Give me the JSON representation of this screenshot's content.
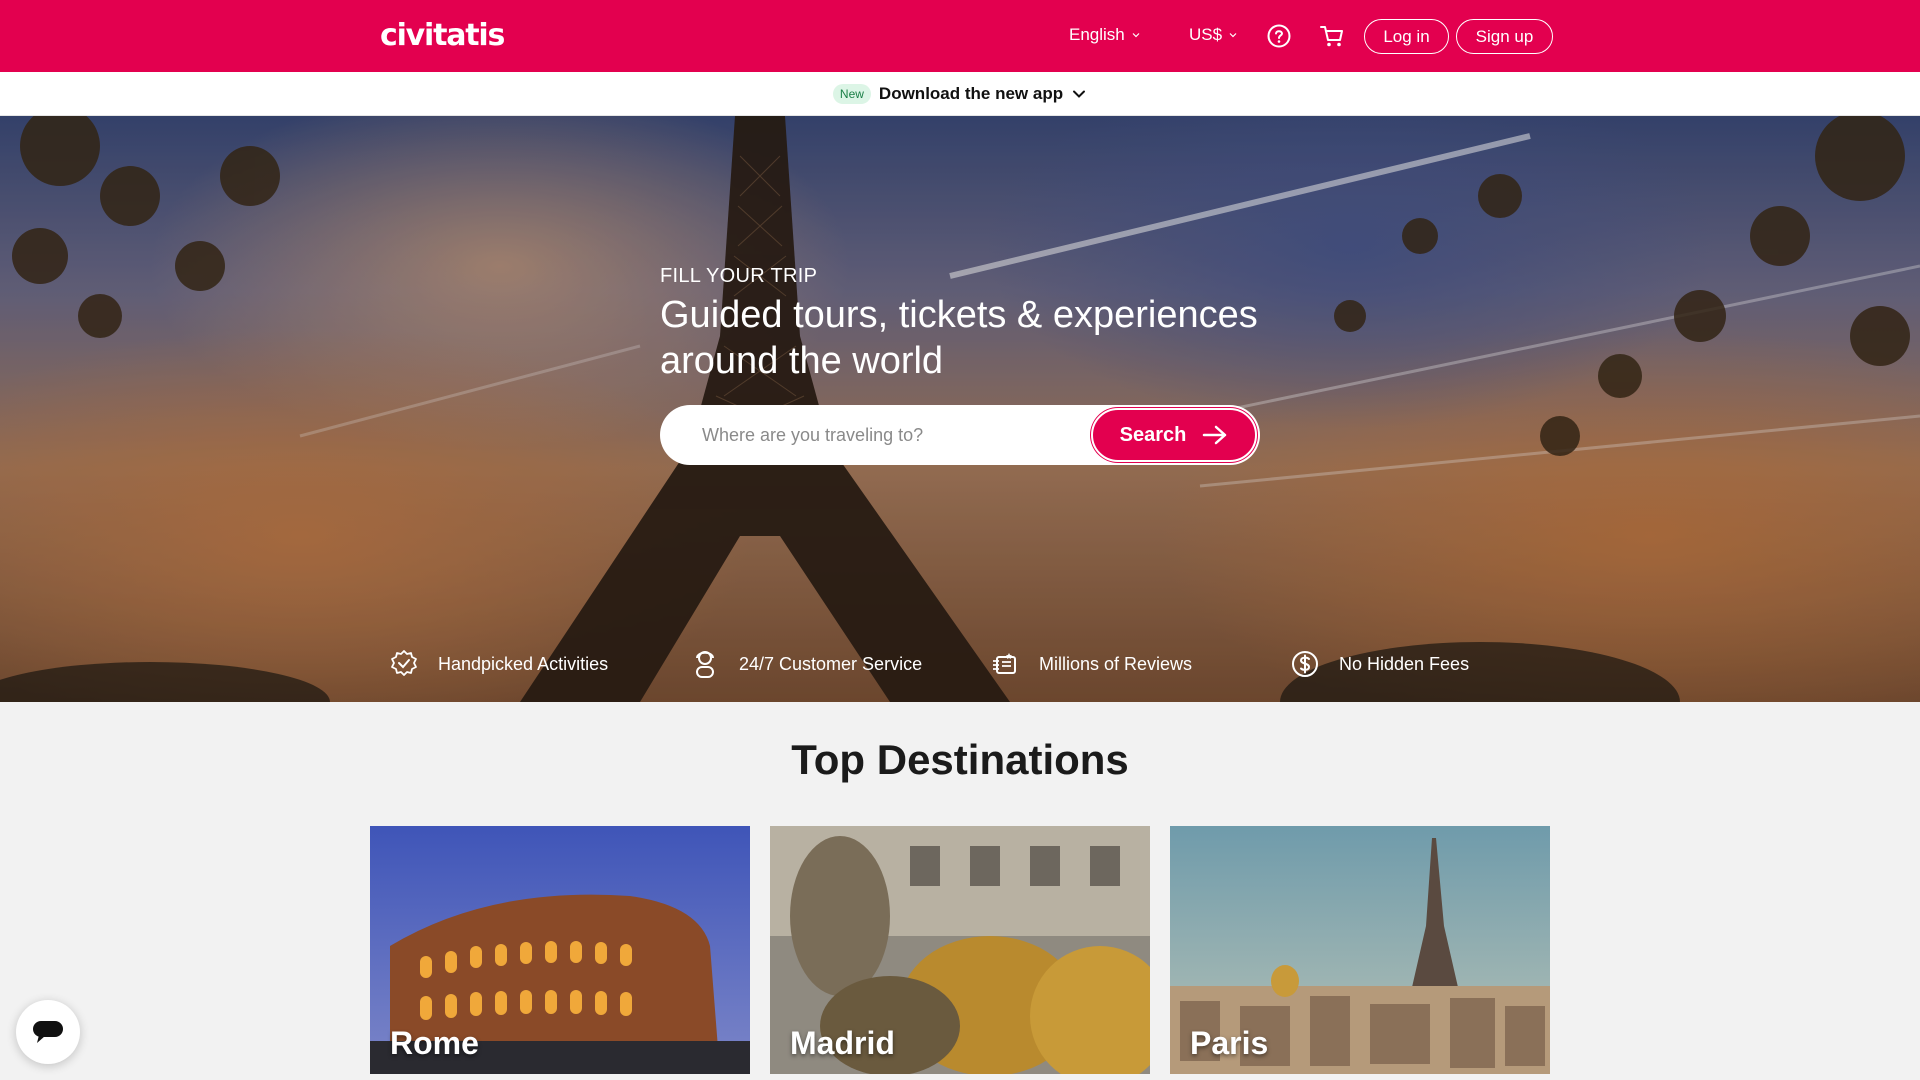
{
  "header": {
    "logo": "civitatis",
    "language": "English",
    "currency": "US$",
    "login_label": "Log in",
    "signup_label": "Sign up"
  },
  "app_banner": {
    "badge": "New",
    "label": "Download the new app"
  },
  "hero": {
    "kicker": "FILL YOUR TRIP",
    "headline": "Guided tours, tickets & experiences around the world",
    "search_placeholder": "Where are you traveling to?",
    "search_button": "Search",
    "features": [
      {
        "icon": "verified-badge-icon",
        "label": "Handpicked Activities"
      },
      {
        "icon": "customer-service-icon",
        "label": "24/7 Customer Service"
      },
      {
        "icon": "reviews-icon",
        "label": "Millions of Reviews"
      },
      {
        "icon": "dollar-coin-icon",
        "label": "No Hidden Fees"
      }
    ]
  },
  "destinations": {
    "title": "Top Destinations",
    "cards": [
      {
        "city": "Rome"
      },
      {
        "city": "Madrid"
      },
      {
        "city": "Paris"
      }
    ]
  },
  "colors": {
    "brand": "#e3004f",
    "badge_bg": "#dcf5e6",
    "badge_text": "#1a7f46"
  }
}
